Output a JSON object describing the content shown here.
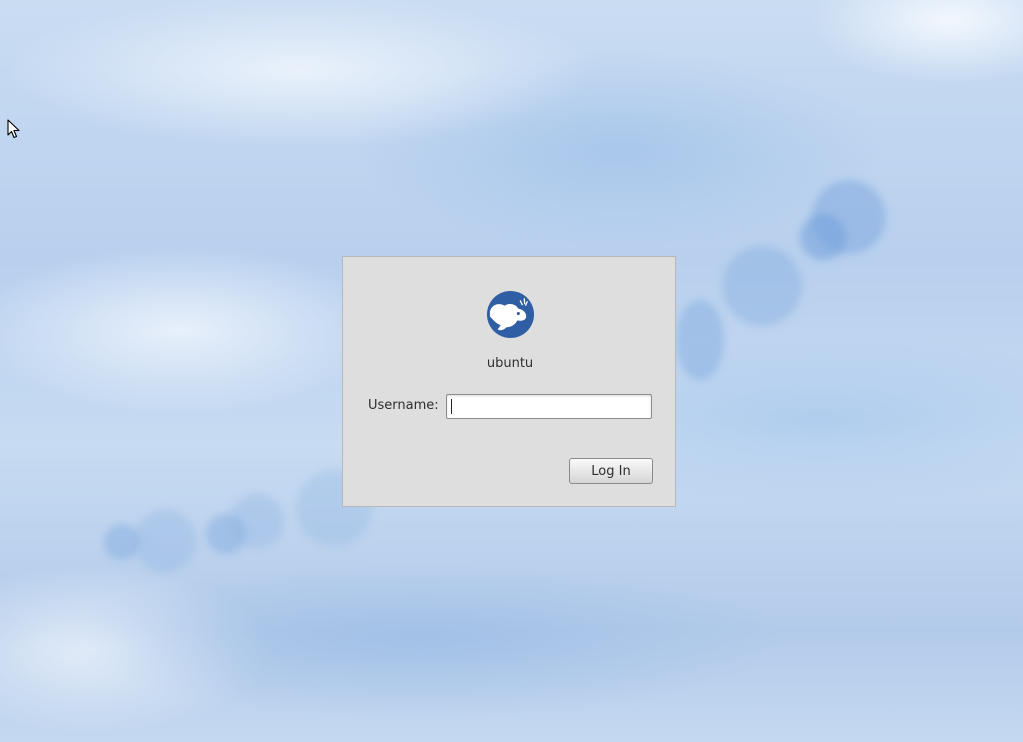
{
  "screen": {
    "wallpaper": "blue-blurred-bokeh",
    "pointer_icon": "mouse-pointer-icon"
  },
  "login": {
    "logo_icon": "xfce-mouse-logo-icon",
    "logo_color": "#2f5ea5",
    "hostname": "ubuntu",
    "username_label": "Username:",
    "username_value": "",
    "login_button_label": "Log In"
  }
}
